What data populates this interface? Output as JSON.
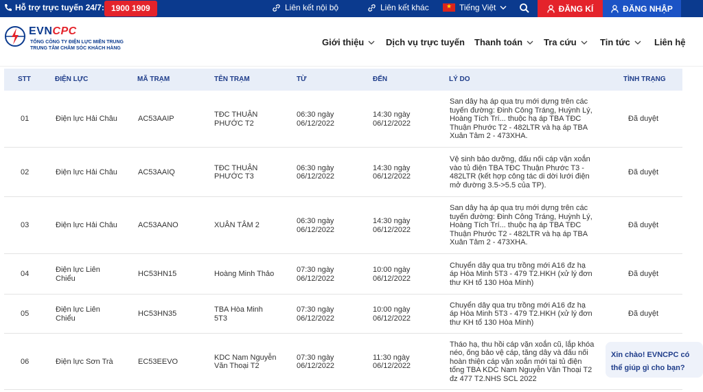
{
  "topbar": {
    "support_label": "Hỗ trợ trực tuyến 24/7:",
    "hotline": "1900 1909",
    "internal_link": "Liên kết nội bộ",
    "other_link": "Liên kết khác",
    "language": "Tiếng Việt",
    "register": "ĐĂNG KÍ",
    "login": "ĐĂNG NHẬP"
  },
  "header": {
    "brand_evn": "EVN",
    "brand_cpc": "CPC",
    "sub1": "TỔNG CÔNG TY ĐIỆN LỰC MIỀN TRUNG",
    "sub2": "TRUNG TÂM CHĂM SÓC KHÁCH HÀNG",
    "nav": [
      "Giới thiệu",
      "Dịch vụ trực tuyến",
      "Thanh toán",
      "Tra cứu",
      "Tin tức",
      "Liên hệ"
    ]
  },
  "table": {
    "headers": [
      "STT",
      "ĐIỆN LỰC",
      "MÃ TRẠM",
      "TÊN TRẠM",
      "TỪ",
      "ĐẾN",
      "LÝ DO",
      "TÌNH TRẠNG"
    ],
    "rows": [
      {
        "stt": "01",
        "dien_luc": [
          "Điện lực Hải Châu"
        ],
        "ma_tram": "AC53AAIP",
        "ten_tram": [
          "TĐC THUẬN",
          "PHƯỚC T2"
        ],
        "tu": [
          "06:30 ngày",
          "06/12/2022"
        ],
        "den": [
          "14:30 ngày",
          "06/12/2022"
        ],
        "ly_do": [
          "San dây hạ áp qua trụ mới dựng trên các",
          "tuyến đường: Đinh Công Tráng, Huỳnh Lý,",
          "Hoàng Tích Trí... thuộc hạ áp TBA TĐC",
          "Thuận Phước T2 - 482LTR và hạ áp TBA",
          "Xuân Tâm 2 - 473XHA."
        ],
        "tinh_trang": "Đã duyệt"
      },
      {
        "stt": "02",
        "dien_luc": [
          "Điện lực Hải Châu"
        ],
        "ma_tram": "AC53AAIQ",
        "ten_tram": [
          "TĐC THUẬN",
          "PHƯỚC T3"
        ],
        "tu": [
          "06:30 ngày",
          "06/12/2022"
        ],
        "den": [
          "14:30 ngày",
          "06/12/2022"
        ],
        "ly_do": [
          "Vệ sinh bảo dưỡng, đấu nối cáp vặn xoắn",
          "vào tủ điện TBA TĐC Thuận Phước T3 -",
          "482LTR (kết hợp công tác di dời lưới điện",
          "mở đường 3.5->5.5 của TP)."
        ],
        "tinh_trang": "Đã duyệt"
      },
      {
        "stt": "03",
        "dien_luc": [
          "Điện lực Hải Châu"
        ],
        "ma_tram": "AC53AANO",
        "ten_tram": [
          "XUÂN TÂM 2"
        ],
        "tu": [
          "06:30 ngày",
          "06/12/2022"
        ],
        "den": [
          "14:30 ngày",
          "06/12/2022"
        ],
        "ly_do": [
          "San dây hạ áp qua trụ mới dựng trên các",
          "tuyến đường: Đinh Công Tráng, Huỳnh Lý,",
          "Hoàng Tích Trí... thuộc hạ áp TBA TĐC",
          "Thuận Phước T2 - 482LTR và hạ áp TBA",
          "Xuân Tâm 2 - 473XHA."
        ],
        "tinh_trang": "Đã duyệt"
      },
      {
        "stt": "04",
        "dien_luc": [
          "Điện lực Liên",
          "Chiểu"
        ],
        "ma_tram": "HC53HN15",
        "ten_tram": [
          "Hoàng Minh Thảo"
        ],
        "tu": [
          "07:30 ngày",
          "06/12/2022"
        ],
        "den": [
          "10:00 ngày",
          "06/12/2022"
        ],
        "ly_do": [
          "Chuyển dây qua trụ trồng mới A16 đz hạ",
          "áp Hòa Minh 5T3 - 479 T2.HKH (xử lý đơn",
          "thư KH tổ 130 Hòa Minh)"
        ],
        "tinh_trang": "Đã duyệt"
      },
      {
        "stt": "05",
        "dien_luc": [
          "Điện lực Liên",
          "Chiểu"
        ],
        "ma_tram": "HC53HN35",
        "ten_tram": [
          "TBA Hòa Minh",
          "5T3"
        ],
        "tu": [
          "07:30 ngày",
          "06/12/2022"
        ],
        "den": [
          "10:00 ngày",
          "06/12/2022"
        ],
        "ly_do": [
          "Chuyển dây qua trụ trồng mới A16 đz hạ",
          "áp Hòa Minh 5T3 - 479 T2.HKH (xử lý đơn",
          "thư KH tổ 130 Hòa Minh)"
        ],
        "tinh_trang": "Đã duyệt"
      },
      {
        "stt": "06",
        "dien_luc": [
          "Điện lực Sơn Trà"
        ],
        "ma_tram": "EC53EEVO",
        "ten_tram": [
          "KDC Nam Nguyễn",
          "Văn Thoại T2"
        ],
        "tu": [
          "07:30 ngày",
          "06/12/2022"
        ],
        "den": [
          "11:30 ngày",
          "06/12/2022"
        ],
        "ly_do": [
          "Tháo hạ, thu hồi cáp vặn xoắn cũ, lắp khóa",
          "néo, ống bảo vệ cáp, tăng dây và đấu nối",
          "hoàn thiện cáp vặn xoắn mới tại tủ điện",
          "tổng TBA KDC Nam Nguyễn Văn Thoại T2",
          "đz 477 T2.NHS SCL 2022"
        ],
        "tinh_trang": ""
      }
    ]
  },
  "chat": {
    "line1": "Xin chào! EVNCPC có",
    "line2": "thể giúp gì cho bạn?"
  }
}
